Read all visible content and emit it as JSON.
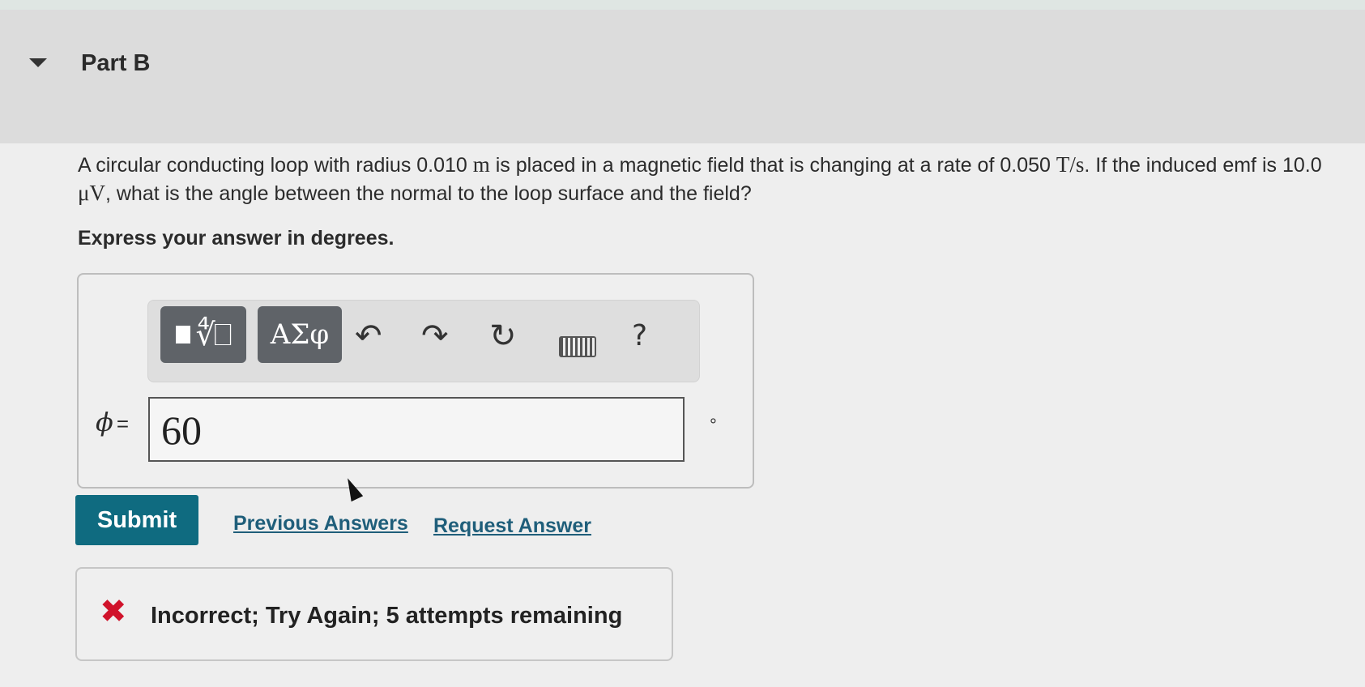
{
  "part": {
    "title": "Part B"
  },
  "question": {
    "line1a": "A circular conducting loop with radius 0.010 ",
    "unit_m": "m",
    "line1b": " is placed in a magnetic field that is changing at a rate of 0.050 ",
    "unit_ts": "T/s",
    "line1c": ". If the induced emf is 10.0 ",
    "unit_uv": "μV",
    "line1d": ", what is the angle between the normal to the loop surface and the field?",
    "instruction": "Express your answer in degrees."
  },
  "toolbar": {
    "template_symbol": "∜⎕",
    "greek_label": "ΑΣφ",
    "undo_icon": "undo-icon",
    "redo_icon": "redo-icon",
    "reset_icon": "reset-icon",
    "keyboard_icon": "keyboard-icon",
    "help_label": "?"
  },
  "answer": {
    "variable": "ϕ",
    "equals": "=",
    "value": "60",
    "unit": "°"
  },
  "actions": {
    "submit": "Submit",
    "previous": "Previous Answers",
    "request": "Request Answer"
  },
  "feedback": {
    "text": "Incorrect; Try Again; 5 attempts remaining",
    "status_color": "#d0132b"
  }
}
